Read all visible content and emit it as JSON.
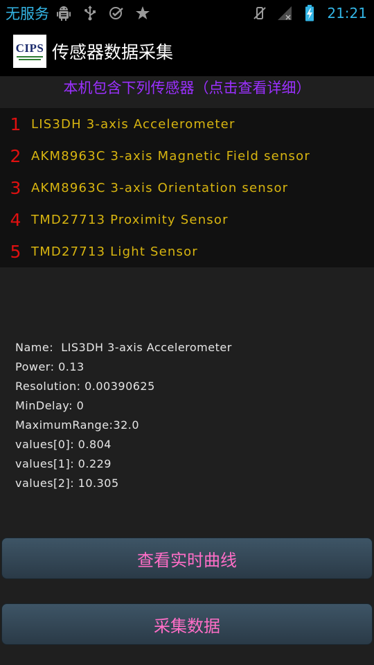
{
  "status_bar": {
    "carrier": "无服务",
    "clock": "21:21",
    "icons": [
      "android-debug-icon",
      "usb-icon",
      "sync-check-icon",
      "star-icon",
      "vibrate-muted-icon",
      "no-signal-icon",
      "battery-charging-icon"
    ]
  },
  "app": {
    "logo_text": "CIPS",
    "title": "传感器数据采集"
  },
  "prompt": "本机包含下列传感器（点击查看详细）",
  "sensors": [
    {
      "index": "1",
      "name": "LIS3DH 3-axis Accelerometer"
    },
    {
      "index": "2",
      "name": "AKM8963C 3-axis Magnetic Field sensor"
    },
    {
      "index": "3",
      "name": "AKM8963C 3-axis Orientation sensor"
    },
    {
      "index": "4",
      "name": "TMD27713 Proximity Sensor"
    },
    {
      "index": "5",
      "name": "TMD27713 Light Sensor"
    }
  ],
  "details": {
    "name": "Name:  LIS3DH 3-axis Accelerometer",
    "power": "Power: 0.13",
    "resolution": "Resolution: 0.00390625",
    "min_delay": "MinDelay: 0",
    "max_range": "MaximumRange:32.0",
    "value0": "values[0]: 0.804",
    "value1": "values[1]: 0.229",
    "value2": "values[2]: 10.305"
  },
  "buttons": {
    "curve": "查看实时曲线",
    "collect": "采集数据"
  },
  "colors": {
    "status_text": "#33b5e5",
    "prompt": "#9b30ff",
    "sensor_index": "#e01010",
    "sensor_name": "#d8b510",
    "button_text": "#ff6ec7"
  }
}
